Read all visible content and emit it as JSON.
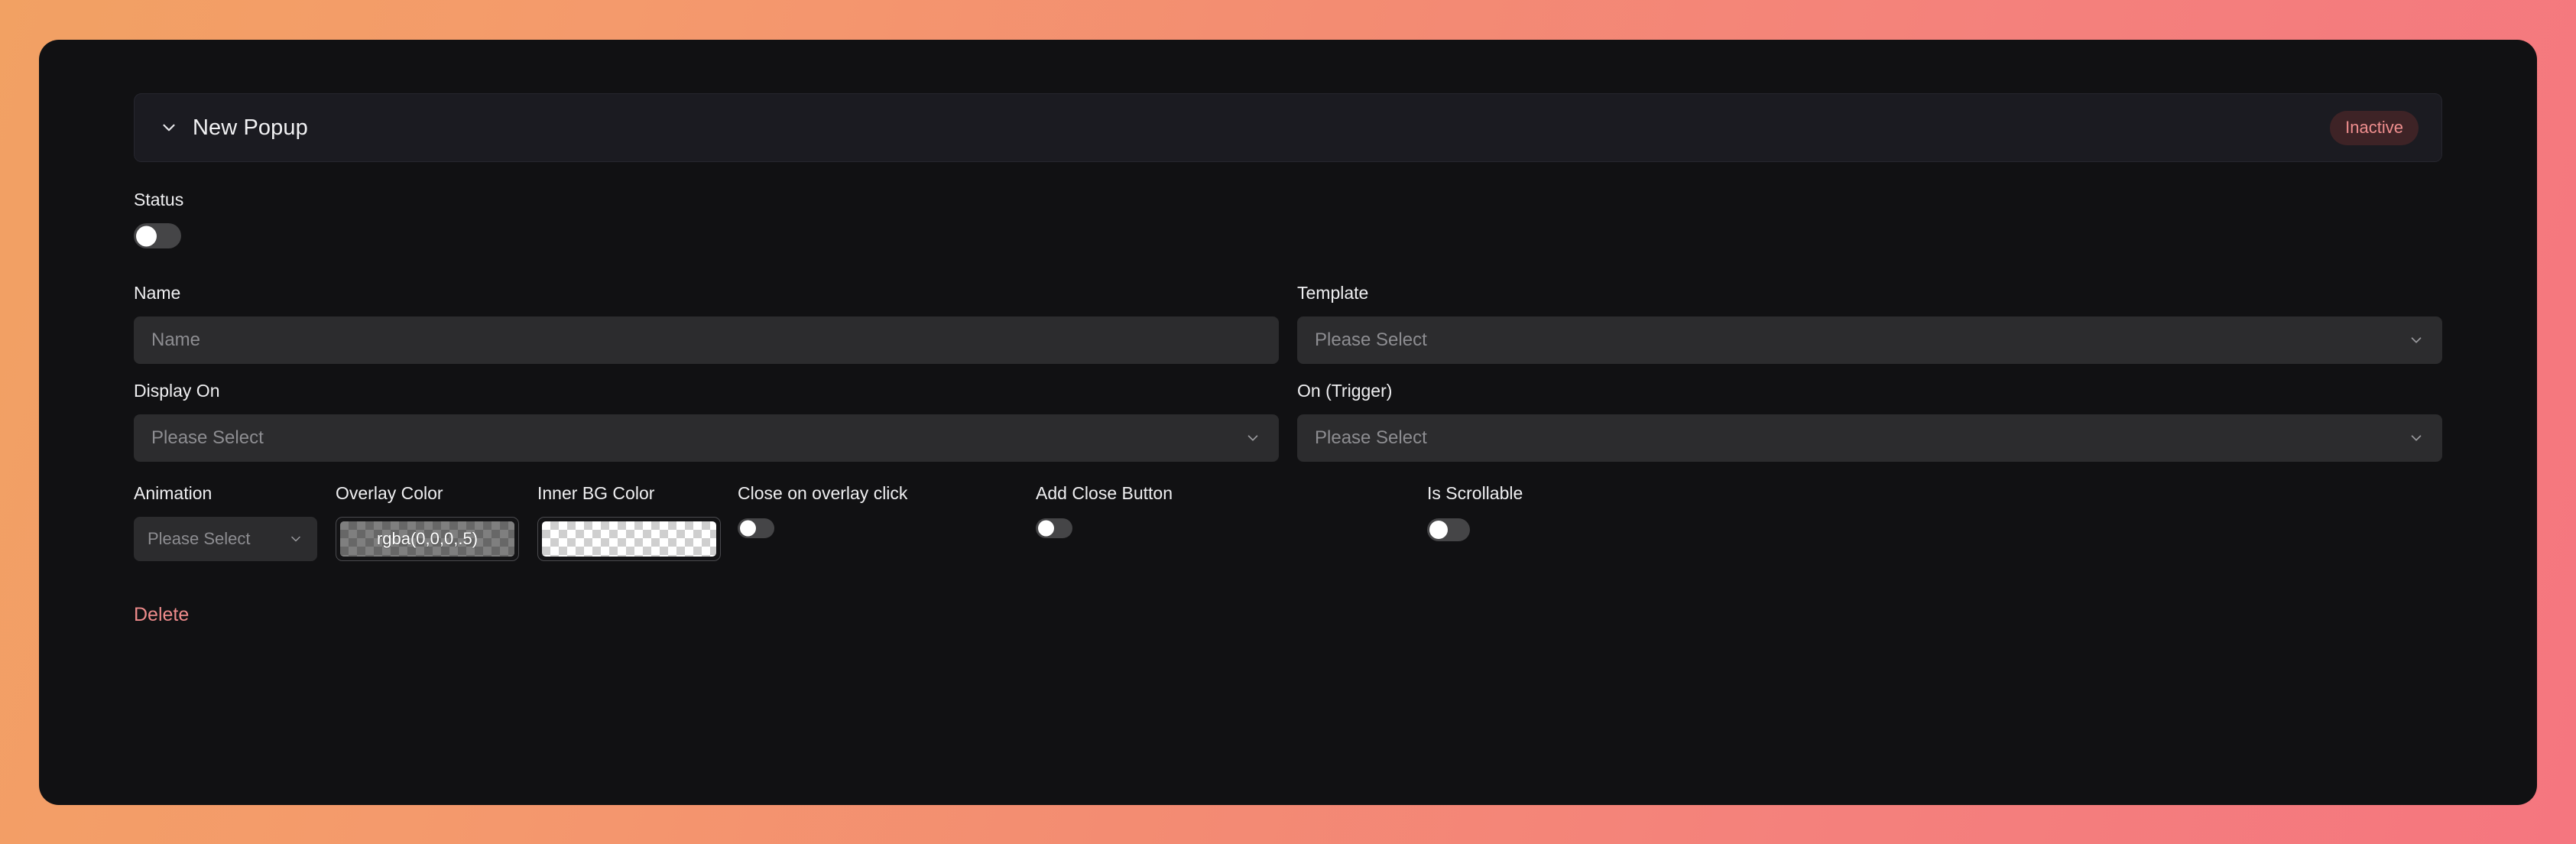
{
  "theme": {
    "page_gradient_from": "#f2a163",
    "page_gradient_to": "#f5767f",
    "panel_bg": "#111113",
    "header_bg": "#1b1b21",
    "input_bg": "#2c2c2e",
    "danger_color": "#ee8b8b",
    "badge_bg": "#3e2326"
  },
  "header": {
    "title": "New Popup",
    "collapse_icon": "chevron-down-icon",
    "status_badge": "Inactive"
  },
  "form": {
    "status": {
      "label": "Status",
      "value": false
    },
    "name": {
      "label": "Name",
      "placeholder": "Name",
      "value": ""
    },
    "template": {
      "label": "Template",
      "value": "Please Select",
      "chevron": "chevron-down-icon"
    },
    "display_on": {
      "label": "Display On",
      "value": "Please Select",
      "chevron": "chevron-down-icon"
    },
    "on_trigger": {
      "label": "On (Trigger)",
      "value": "Please Select",
      "chevron": "chevron-down-icon"
    },
    "animation": {
      "label": "Animation",
      "value": "Please Select",
      "chevron": "chevron-down-icon"
    },
    "overlay_color": {
      "label": "Overlay Color",
      "value": "rgba(0,0,0,.5)",
      "swatch_css": "rgba(0,0,0,.5)"
    },
    "inner_bg_color": {
      "label": "Inner BG Color",
      "value": "",
      "swatch_css": "rgba(0,0,0,0)"
    },
    "close_on_overlay_click": {
      "label": "Close on overlay click",
      "value": false
    },
    "add_close_button": {
      "label": "Add Close Button",
      "value": false
    },
    "is_scrollable": {
      "label": "Is Scrollable",
      "value": false
    }
  },
  "actions": {
    "delete_label": "Delete"
  }
}
